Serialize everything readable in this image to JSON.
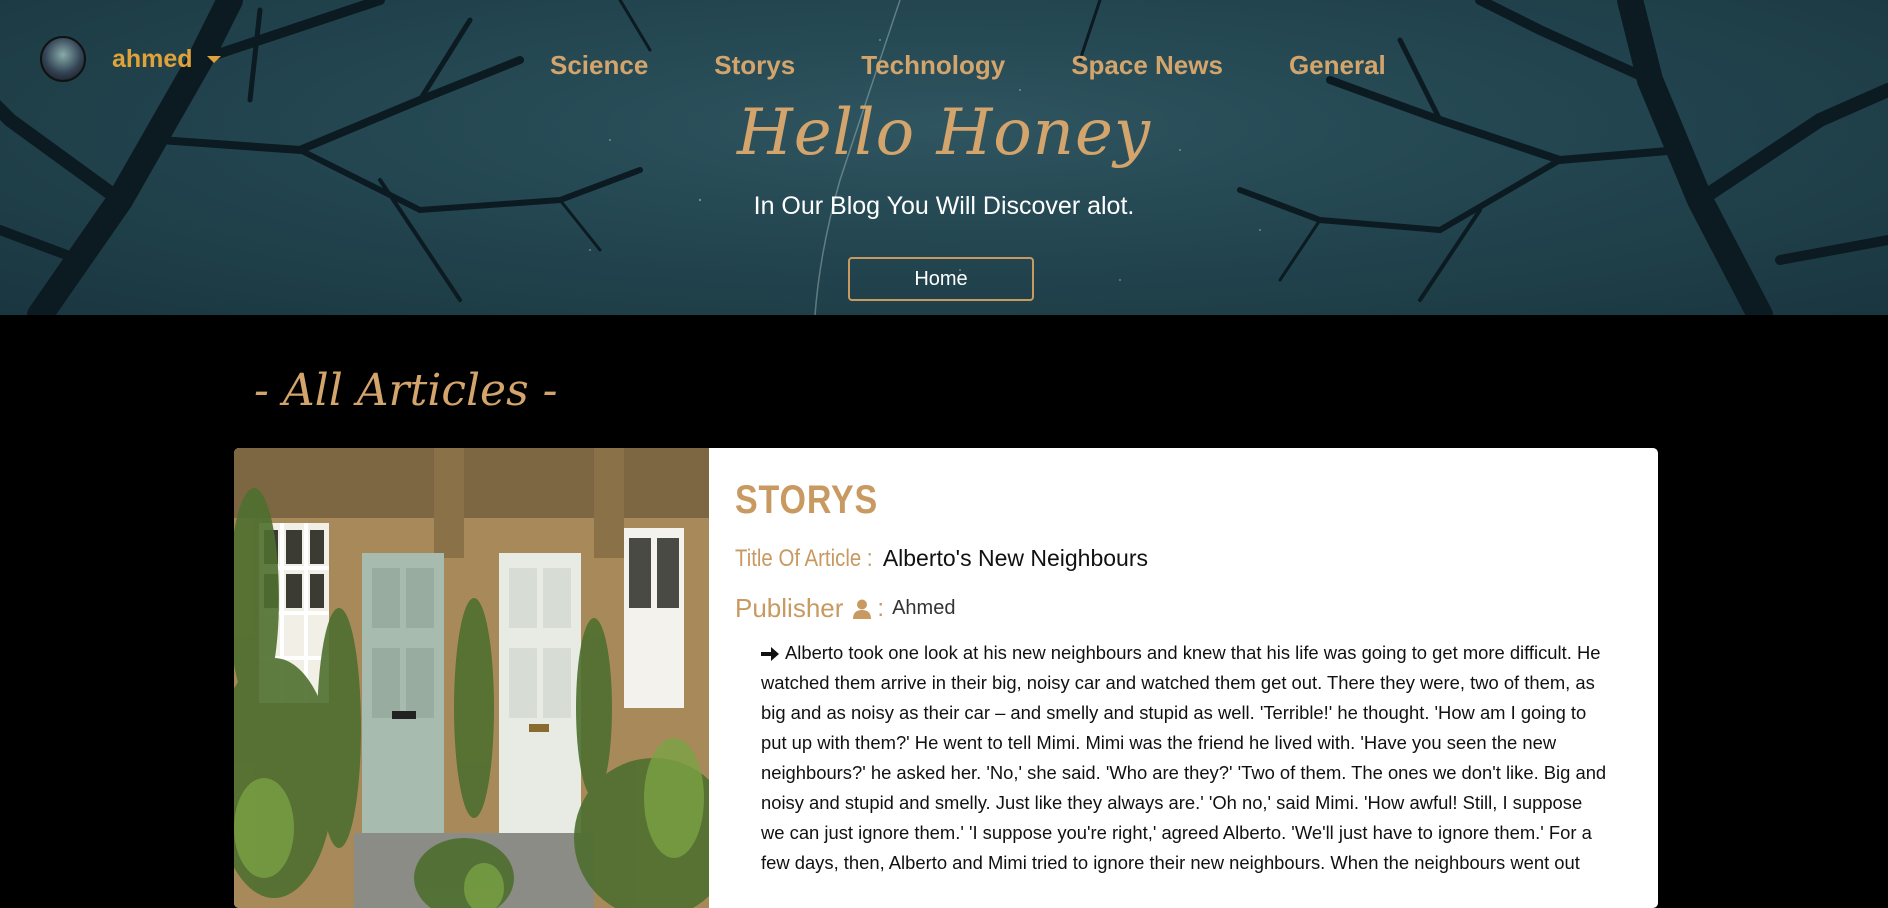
{
  "header": {
    "user": {
      "name": "ahmed",
      "avatar_icon": "avatar-image",
      "dropdown_icon": "caret-down-icon"
    },
    "nav": [
      "Science",
      "Storys",
      "Technology",
      "Space News",
      "General"
    ],
    "title": "Hello Honey",
    "subtitle": "In Our Blog You Will Discover alot.",
    "home_button": "Home"
  },
  "section": {
    "title": "- All Articles -"
  },
  "article": {
    "category": "STORYS",
    "title_label": "Title Of Article :",
    "title": "Alberto's New Neighbours",
    "publisher_label": "Publisher",
    "publisher_icon": "user-icon",
    "publisher_colon": ":",
    "publisher": "Ahmed",
    "bullet_icon": "arrow-right-icon",
    "text": "Alberto took one look at his new neighbours and knew that his life was going to get more difficult. He watched them arrive in their big, noisy car and watched them get out. There they were, two of them, as big and as noisy as their car – and smelly and stupid as well. 'Terrible!' he thought. 'How am I going to put up with them?' He went to tell Mimi. Mimi was the friend he lived with. 'Have you seen the new neighbours?' he asked her. 'No,' she said. 'Who are they?' 'Two of them. The ones we don't like. Big and noisy and stupid and smelly. Just like they always are.' 'Oh no,' said Mimi. 'How awful! Still, I suppose we can just ignore them.' 'I suppose you're right,' agreed Alberto. 'We'll just have to ignore them.' For a few days, then, Alberto and Mimi tried to ignore their new neighbours. When the neighbours went out"
  },
  "colors": {
    "accent": "#d3a46b",
    "hero_bg": "#234650",
    "page_bg": "#000000",
    "user_accent": "#e0a33a"
  }
}
